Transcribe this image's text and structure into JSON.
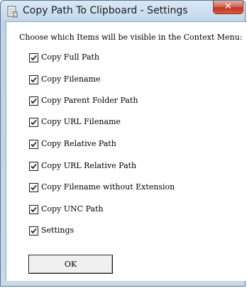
{
  "window": {
    "title": "Copy Path To Clipboard - Settings",
    "close_glyph": "✕"
  },
  "intro": "Choose which Items will be visible in the Context Menu:",
  "items": [
    {
      "label": "Copy Full Path",
      "checked": true
    },
    {
      "label": "Copy Filename",
      "checked": true
    },
    {
      "label": "Copy Parent Folder Path",
      "checked": true
    },
    {
      "label": "Copy URL Filename",
      "checked": true
    },
    {
      "label": "Copy Relative Path",
      "checked": true
    },
    {
      "label": "Copy URL Relative Path",
      "checked": true
    },
    {
      "label": "Copy Filename without Extension",
      "checked": true
    },
    {
      "label": "Copy UNC Path",
      "checked": true
    },
    {
      "label": "Settings",
      "checked": true
    }
  ],
  "ok_label": "OK"
}
